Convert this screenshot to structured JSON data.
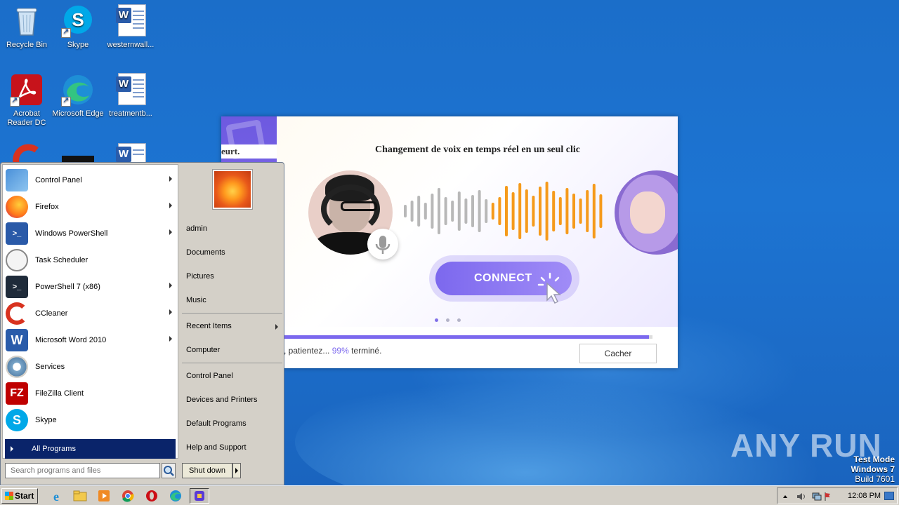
{
  "desktop": {
    "icons": [
      {
        "label": "Recycle Bin"
      },
      {
        "label": "Skype"
      },
      {
        "label": "westernwall..."
      },
      {
        "label": "Acrobat Reader DC"
      },
      {
        "label": "Microsoft Edge"
      },
      {
        "label": "treatmentb..."
      }
    ]
  },
  "app": {
    "banner_left_text": "eurt.",
    "banner_title": "Changement de voix en temps réel en un seul clic",
    "connect_label": "CONNECT",
    "progress_percent": 99,
    "status_prefix": ", patientez...",
    "status_percent": "99%",
    "status_suffix": "terminé.",
    "hide_label": "Cacher",
    "colors": {
      "accent": "#7b68ee",
      "wave_gray": "#b8b8b8",
      "wave_orange": "#f59a1b"
    }
  },
  "start_menu": {
    "programs": [
      {
        "label": "Control Panel",
        "icon": "control-panel-icon",
        "has_arrow": true
      },
      {
        "label": "Firefox",
        "icon": "firefox-icon",
        "has_arrow": true
      },
      {
        "label": "Windows PowerShell",
        "icon": "powershell-icon",
        "has_arrow": true
      },
      {
        "label": "Task Scheduler",
        "icon": "clock-icon",
        "has_arrow": false
      },
      {
        "label": "PowerShell 7 (x86)",
        "icon": "powershell7-icon",
        "has_arrow": true
      },
      {
        "label": "CCleaner",
        "icon": "ccleaner-icon",
        "has_arrow": true
      },
      {
        "label": "Microsoft Word 2010",
        "icon": "word-icon",
        "has_arrow": true
      },
      {
        "label": "Services",
        "icon": "gears-icon",
        "has_arrow": false
      },
      {
        "label": "FileZilla Client",
        "icon": "filezilla-icon",
        "has_arrow": false
      },
      {
        "label": "Skype",
        "icon": "skype-icon",
        "has_arrow": false
      }
    ],
    "all_programs": "All Programs",
    "search_placeholder": "Search programs and files",
    "places": [
      {
        "label": "admin"
      },
      {
        "label": "Documents"
      },
      {
        "label": "Pictures"
      },
      {
        "label": "Music"
      },
      {
        "label": "Recent Items"
      },
      {
        "label": "Computer"
      },
      {
        "label": "Control Panel"
      },
      {
        "label": "Devices and Printers"
      },
      {
        "label": "Default Programs"
      },
      {
        "label": "Help and Support"
      }
    ],
    "shutdown_label": "Shut down"
  },
  "taskbar": {
    "start_label": "Start",
    "pinned": [
      "ie-icon",
      "explorer-icon",
      "media-player-icon",
      "chrome-icon",
      "opera-icon",
      "edge-icon",
      "voice-app-icon"
    ],
    "clock": "12:08 PM"
  },
  "watermark": {
    "text": "ANY RUN",
    "line1": "Test Mode",
    "line2": "Windows 7",
    "line3": "Build 7601"
  }
}
